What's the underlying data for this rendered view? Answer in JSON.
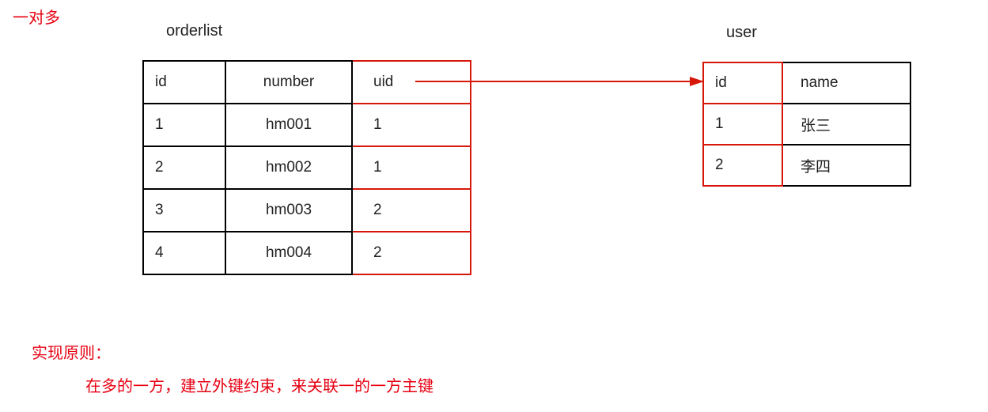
{
  "title_relation": "一对多",
  "orderlist": {
    "label": "orderlist",
    "header": {
      "id": "id",
      "number": "number",
      "uid": "uid"
    },
    "rows": [
      {
        "id": "1",
        "number": "hm001",
        "uid": "1"
      },
      {
        "id": "2",
        "number": "hm002",
        "uid": "1"
      },
      {
        "id": "3",
        "number": "hm003",
        "uid": "2"
      },
      {
        "id": "4",
        "number": "hm004",
        "uid": "2"
      }
    ]
  },
  "user": {
    "label": "user",
    "header": {
      "id": "id",
      "name": "name"
    },
    "rows": [
      {
        "id": "1",
        "name": "张三"
      },
      {
        "id": "2",
        "name": "李四"
      }
    ]
  },
  "principle": {
    "heading": "实现原则：",
    "body": "在多的一方，建立外键约束，来关联一的一方主键"
  },
  "relation": {
    "from_table": "orderlist",
    "from_column": "uid",
    "to_table": "user",
    "to_column": "id",
    "cardinality": "many-to-one"
  }
}
